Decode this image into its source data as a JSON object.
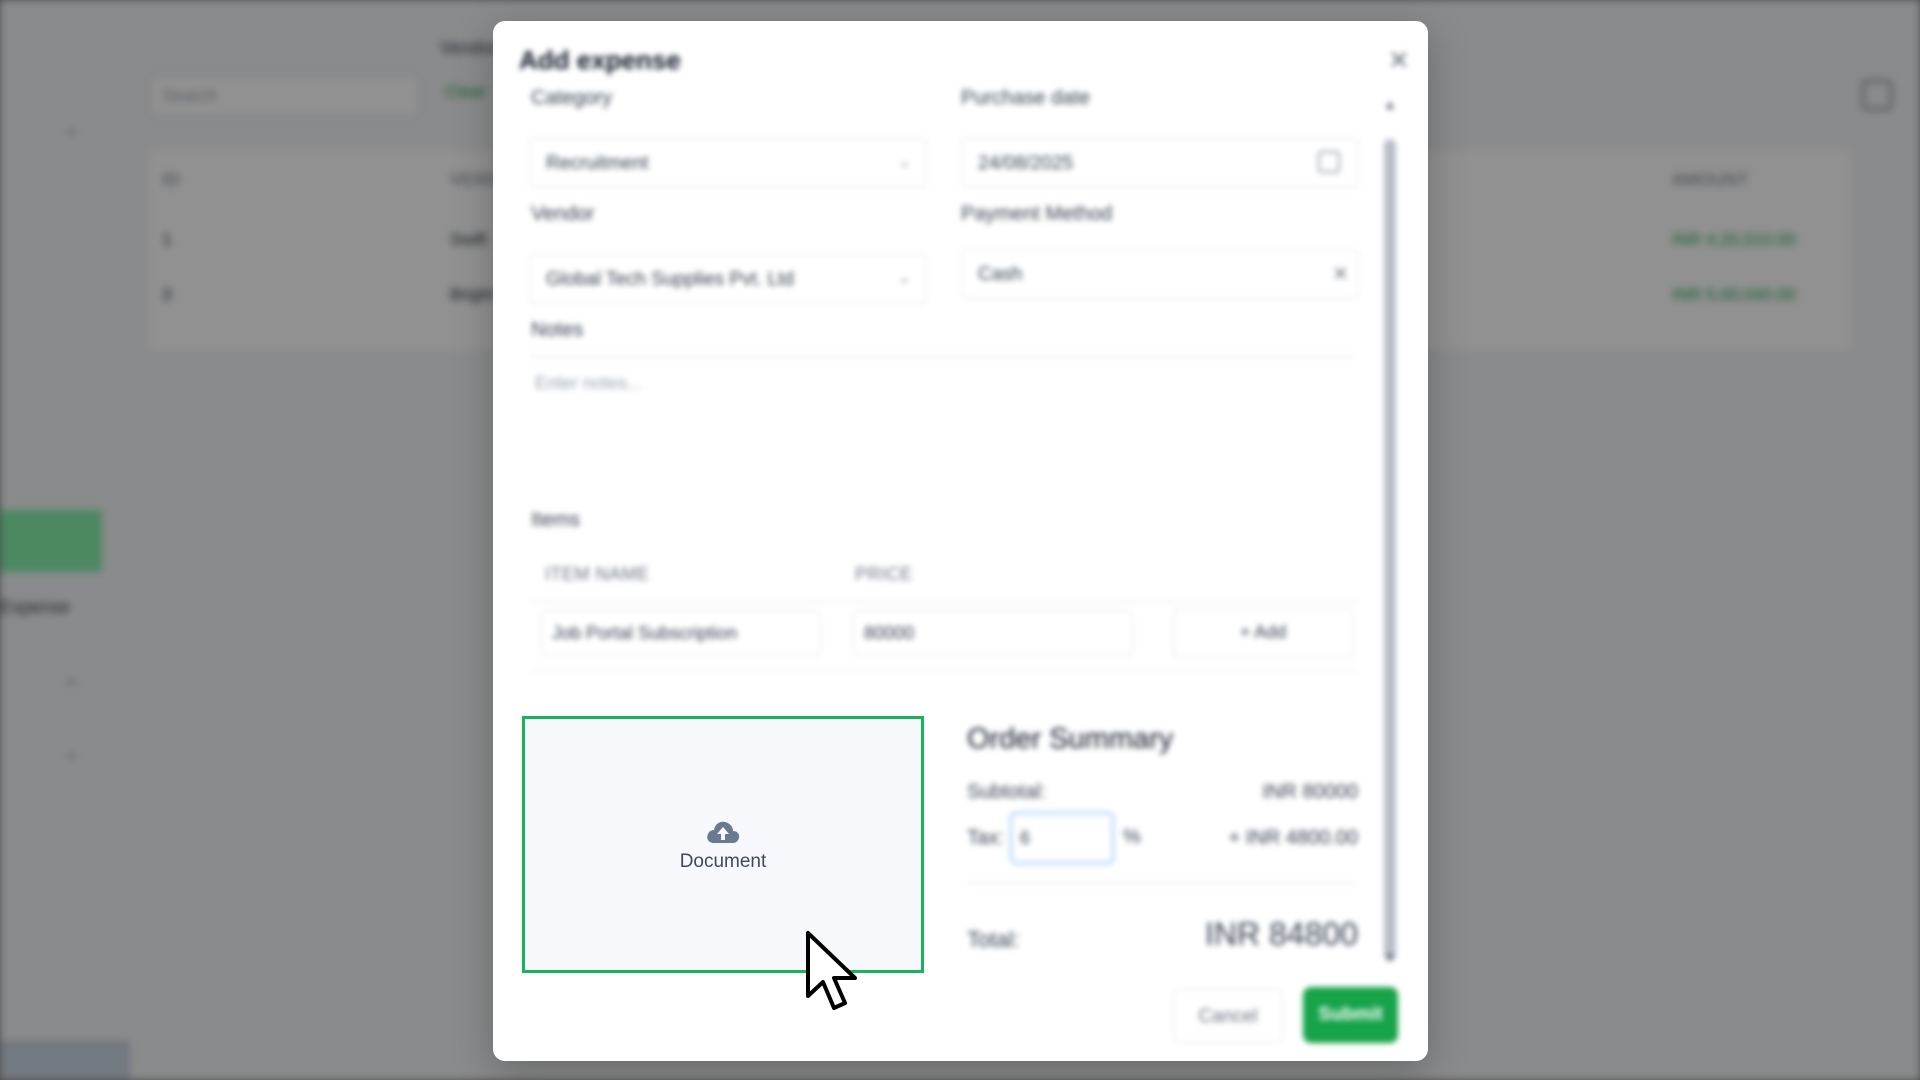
{
  "background": {
    "vendor_label": "Vendor",
    "search_placeholder": "Search",
    "filter_chip": "Clear",
    "table": {
      "headers": [
        "ID",
        "VENDOR",
        "AMOUNT"
      ],
      "rows": [
        {
          "id": "1",
          "vendor": "Swift",
          "currency": "INR",
          "amount": "4,20,010.00"
        },
        {
          "id": "3",
          "vendor": "Bright",
          "currency": "INR",
          "amount": "5,00,040.00"
        }
      ]
    },
    "sidebar": {
      "dropdown_label": "Expense"
    }
  },
  "modal": {
    "title": "Add expense",
    "category": {
      "label": "Category",
      "value": "Recruitment"
    },
    "purchase_date": {
      "label": "Purchase date",
      "value": "24/08/2025"
    },
    "vendor": {
      "label": "Vendor",
      "value": "Global Tech Supplies Pvt. Ltd"
    },
    "payment_method": {
      "label": "Payment Method",
      "value": "Cash"
    },
    "notes": {
      "label": "Notes",
      "placeholder": "Enter notes..."
    },
    "items": {
      "label": "Items",
      "col_item_name": "ITEM NAME",
      "col_price": "PRICE",
      "row": {
        "name": "Job Portal Subscription",
        "price": "80000"
      },
      "add_button": "+ Add"
    },
    "upload": {
      "label": "Document",
      "icon": "cloud-upload-icon"
    },
    "summary": {
      "title": "Order Summary",
      "subtotal_label": "Subtotal:",
      "subtotal_value": "INR 80000",
      "tax_label": "Tax:",
      "tax_value": "6",
      "tax_unit": "%",
      "tax_amount": "+ INR 4800.00",
      "total_label": "Total:",
      "total_value": "INR 84800"
    },
    "cancel_button": "Cancel",
    "submit_button": "Submit"
  },
  "colors": {
    "accent": "#16a34a",
    "upload_border": "#16b55b",
    "upload_bg": "#f6f8fb"
  }
}
